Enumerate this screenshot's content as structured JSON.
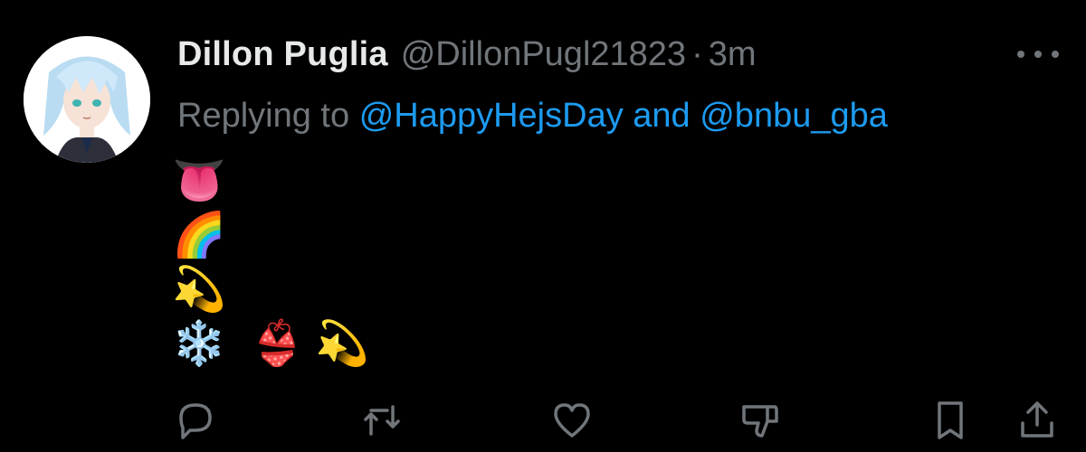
{
  "tweet": {
    "display_name": "Dillon Puglia",
    "handle": "@DillonPugl21823",
    "separator": "·",
    "time": "3m",
    "replying_prefix": "Replying to",
    "mention_1": "@HappyHejsDay",
    "conjunction": "and",
    "mention_2": "@bnbu_gba",
    "emoji_rows": [
      [
        "👅"
      ],
      [
        "🌈"
      ],
      [
        "💫"
      ],
      [
        "❄️",
        "👙",
        "💫"
      ]
    ]
  },
  "icons": {
    "more": "more-horizontal-icon",
    "reply": "reply-icon",
    "retweet": "retweet-icon",
    "like": "like-icon",
    "dislike": "dislike-icon",
    "bookmark": "bookmark-icon",
    "share": "share-icon"
  },
  "colors": {
    "background": "#000000",
    "name": "#e7e9ea",
    "secondary": "#71767b",
    "link": "#1d9bf0"
  }
}
